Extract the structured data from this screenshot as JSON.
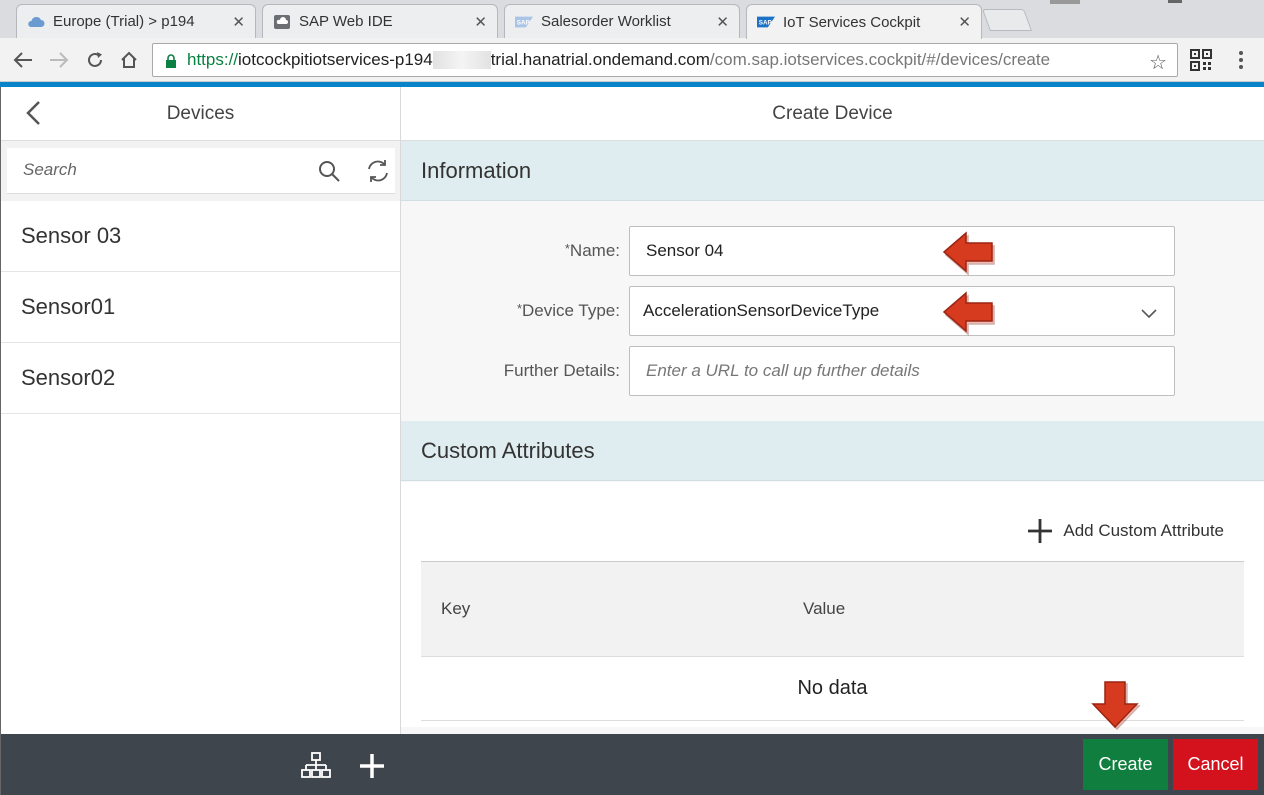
{
  "browser": {
    "tabs": [
      {
        "title": "Europe (Trial) > p194",
        "icon": "cloud-icon"
      },
      {
        "title": "SAP Web IDE",
        "icon": "webide-icon"
      },
      {
        "title": "Salesorder Worklist",
        "icon": "sap-logo-icon"
      },
      {
        "title": "IoT Services Cockpit",
        "icon": "sap-logo-icon",
        "active": true
      }
    ],
    "url": {
      "scheme": "https://",
      "host_start": "iotcockpitiotservices-p194",
      "host_end": "trial.hanatrial.ondemand.com",
      "path": "/com.sap.iotservices.cockpit/#/devices/create"
    }
  },
  "master": {
    "title": "Devices",
    "search_placeholder": "Search",
    "items": [
      {
        "label": "Sensor 03"
      },
      {
        "label": "Sensor01"
      },
      {
        "label": "Sensor02"
      }
    ]
  },
  "detail": {
    "title": "Create Device",
    "information": {
      "heading": "Information",
      "name_label": "Name:",
      "name_value": "Sensor 04",
      "device_type_label": "Device Type:",
      "device_type_value": "AccelerationSensorDeviceType",
      "further_details_label": "Further Details:",
      "further_details_placeholder": "Enter a URL to call up further details",
      "required_marker": "*"
    },
    "custom_attributes": {
      "heading": "Custom Attributes",
      "add_label": "Add Custom Attribute",
      "columns": [
        "Key",
        "Value"
      ],
      "empty_text": "No data"
    },
    "footer": {
      "create_label": "Create",
      "cancel_label": "Cancel"
    }
  },
  "colors": {
    "accent_blue": "#0a84c8",
    "section_header": "#dfedf0",
    "footer_bar": "#3e454c",
    "create_green": "#107e3e",
    "cancel_red": "#d3121e",
    "annotation_arrow": "#d63a1f"
  }
}
